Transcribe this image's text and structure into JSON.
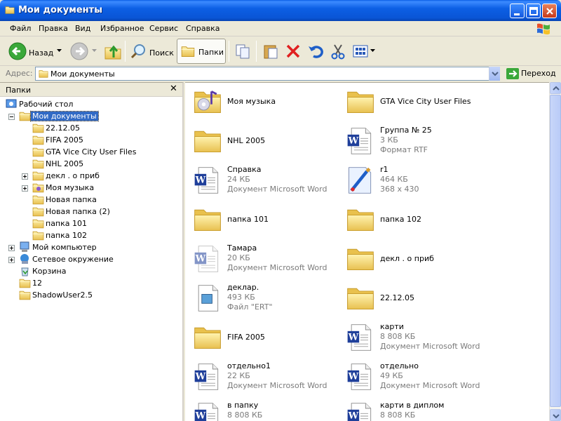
{
  "window": {
    "title": "Мои документы"
  },
  "menu": [
    "Файл",
    "Правка",
    "Вид",
    "Избранное",
    "Сервис",
    "Справка"
  ],
  "toolbar": {
    "back_label": "Назад",
    "search_label": "Поиск",
    "folders_label": "Папки"
  },
  "address": {
    "label": "Адрес:",
    "value": "Мои документы",
    "go_label": "Переход"
  },
  "folders_pane": {
    "title": "Папки",
    "items": [
      {
        "label": "Рабочий стол"
      },
      {
        "label": "Мои документы"
      },
      {
        "label": "22.12.05"
      },
      {
        "label": "FIFA 2005"
      },
      {
        "label": "GTA Vice City User Files"
      },
      {
        "label": "NHL 2005"
      },
      {
        "label": "декл . о приб"
      },
      {
        "label": "Моя музыка"
      },
      {
        "label": "Новая папка"
      },
      {
        "label": "Новая папка (2)"
      },
      {
        "label": "папка 101"
      },
      {
        "label": "папка 102"
      },
      {
        "label": "Мой компьютер"
      },
      {
        "label": "Сетевое окружение"
      },
      {
        "label": "Корзина"
      },
      {
        "label": "12"
      },
      {
        "label": "ShadowUser2.5"
      }
    ]
  },
  "files": [
    {
      "name": "Моя музыка",
      "icon": "music-folder-icon"
    },
    {
      "name": "GTA Vice City User Files",
      "icon": "folder-icon"
    },
    {
      "name": "NHL 2005",
      "icon": "folder-icon"
    },
    {
      "name": "Группа № 25",
      "size": "3 КБ",
      "type": "Формат RTF",
      "icon": "word-document-icon"
    },
    {
      "name": "Справка",
      "size": "24 КБ",
      "type": "Документ Microsoft Word",
      "icon": "word-document-icon"
    },
    {
      "name": "r1",
      "size": "464 КБ",
      "type": "368 x 430",
      "icon": "paint-image-icon"
    },
    {
      "name": "папка 101",
      "icon": "folder-icon"
    },
    {
      "name": "папка 102",
      "icon": "folder-icon"
    },
    {
      "name": "Тамара",
      "size": "20 КБ",
      "type": "Документ Microsoft Word",
      "icon": "word-document-icon"
    },
    {
      "name": "декл . о приб",
      "icon": "folder-icon"
    },
    {
      "name": "деклар.",
      "size": "493 КБ",
      "type": "Файл \"ERT\"",
      "icon": "generic-file-icon"
    },
    {
      "name": "22.12.05",
      "icon": "folder-icon"
    },
    {
      "name": "FIFA 2005",
      "icon": "folder-icon"
    },
    {
      "name": "карти",
      "size": "8 808 КБ",
      "type": "Документ Microsoft Word",
      "icon": "word-document-icon"
    },
    {
      "name": "отдельно1",
      "size": "22 КБ",
      "type": "Документ Microsoft Word",
      "icon": "word-document-icon"
    },
    {
      "name": "отдельно",
      "size": "49 КБ",
      "type": "Документ Microsoft Word",
      "icon": "word-document-icon"
    },
    {
      "name": "в папку",
      "size": "8 808 КБ",
      "icon": "word-document-icon"
    },
    {
      "name": "карти в диплом",
      "size": "8 808 КБ",
      "icon": "word-document-icon"
    }
  ],
  "colors": {
    "titlebar": "#0a55d6",
    "selection": "#316ac5",
    "folder": "#f5d76e"
  }
}
